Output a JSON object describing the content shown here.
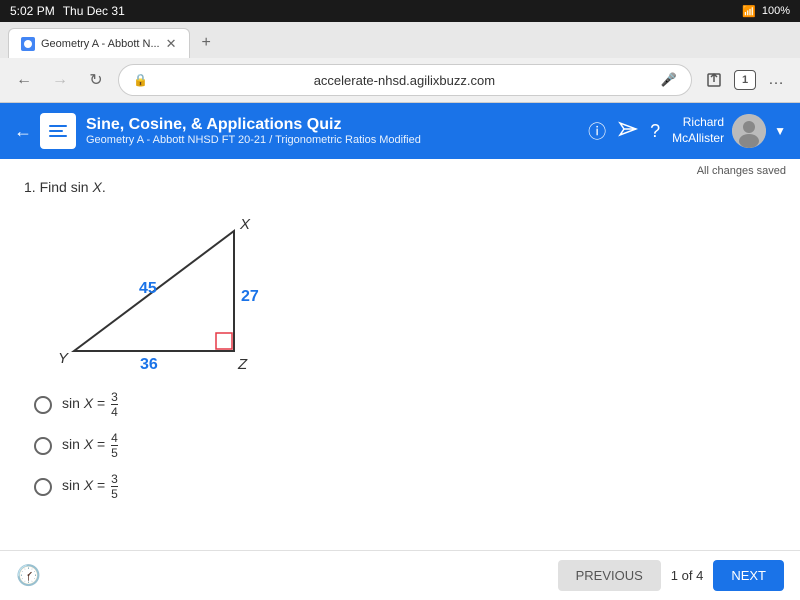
{
  "status_bar": {
    "time": "5:02 PM",
    "date": "Thu Dec 31",
    "battery": "100%"
  },
  "browser": {
    "tab_title": "Geometry A - Abbott N...",
    "address": "accelerate-nhsd.agilixbuzz.com",
    "tab_count": "1"
  },
  "header": {
    "title": "Sine, Cosine, & Applications Quiz",
    "subtitle": "Geometry A - Abbott NHSD FT 20-21 / Trigonometric Ratios Modified",
    "user_name_line1": "Richard",
    "user_name_line2": "McAllister",
    "changes_saved": "All changes saved"
  },
  "question": {
    "number": "1.",
    "text": "Find sin X.",
    "triangle": {
      "side_hyp": "45",
      "side_vert": "27",
      "side_horiz": "36",
      "vertex_top": "X",
      "vertex_bottom_left": "Y",
      "vertex_bottom_right": "Z"
    }
  },
  "choices": [
    {
      "id": "a",
      "text": "sin X = ",
      "numer": "3",
      "denom": "4"
    },
    {
      "id": "b",
      "text": "sin X = ",
      "numer": "4",
      "denom": "5"
    },
    {
      "id": "c",
      "text": "sin X = ",
      "numer": "3",
      "denom": "5"
    }
  ],
  "footer": {
    "prev_label": "PREVIOUS",
    "next_label": "NEXT",
    "page_indicator": "1 of 4"
  }
}
